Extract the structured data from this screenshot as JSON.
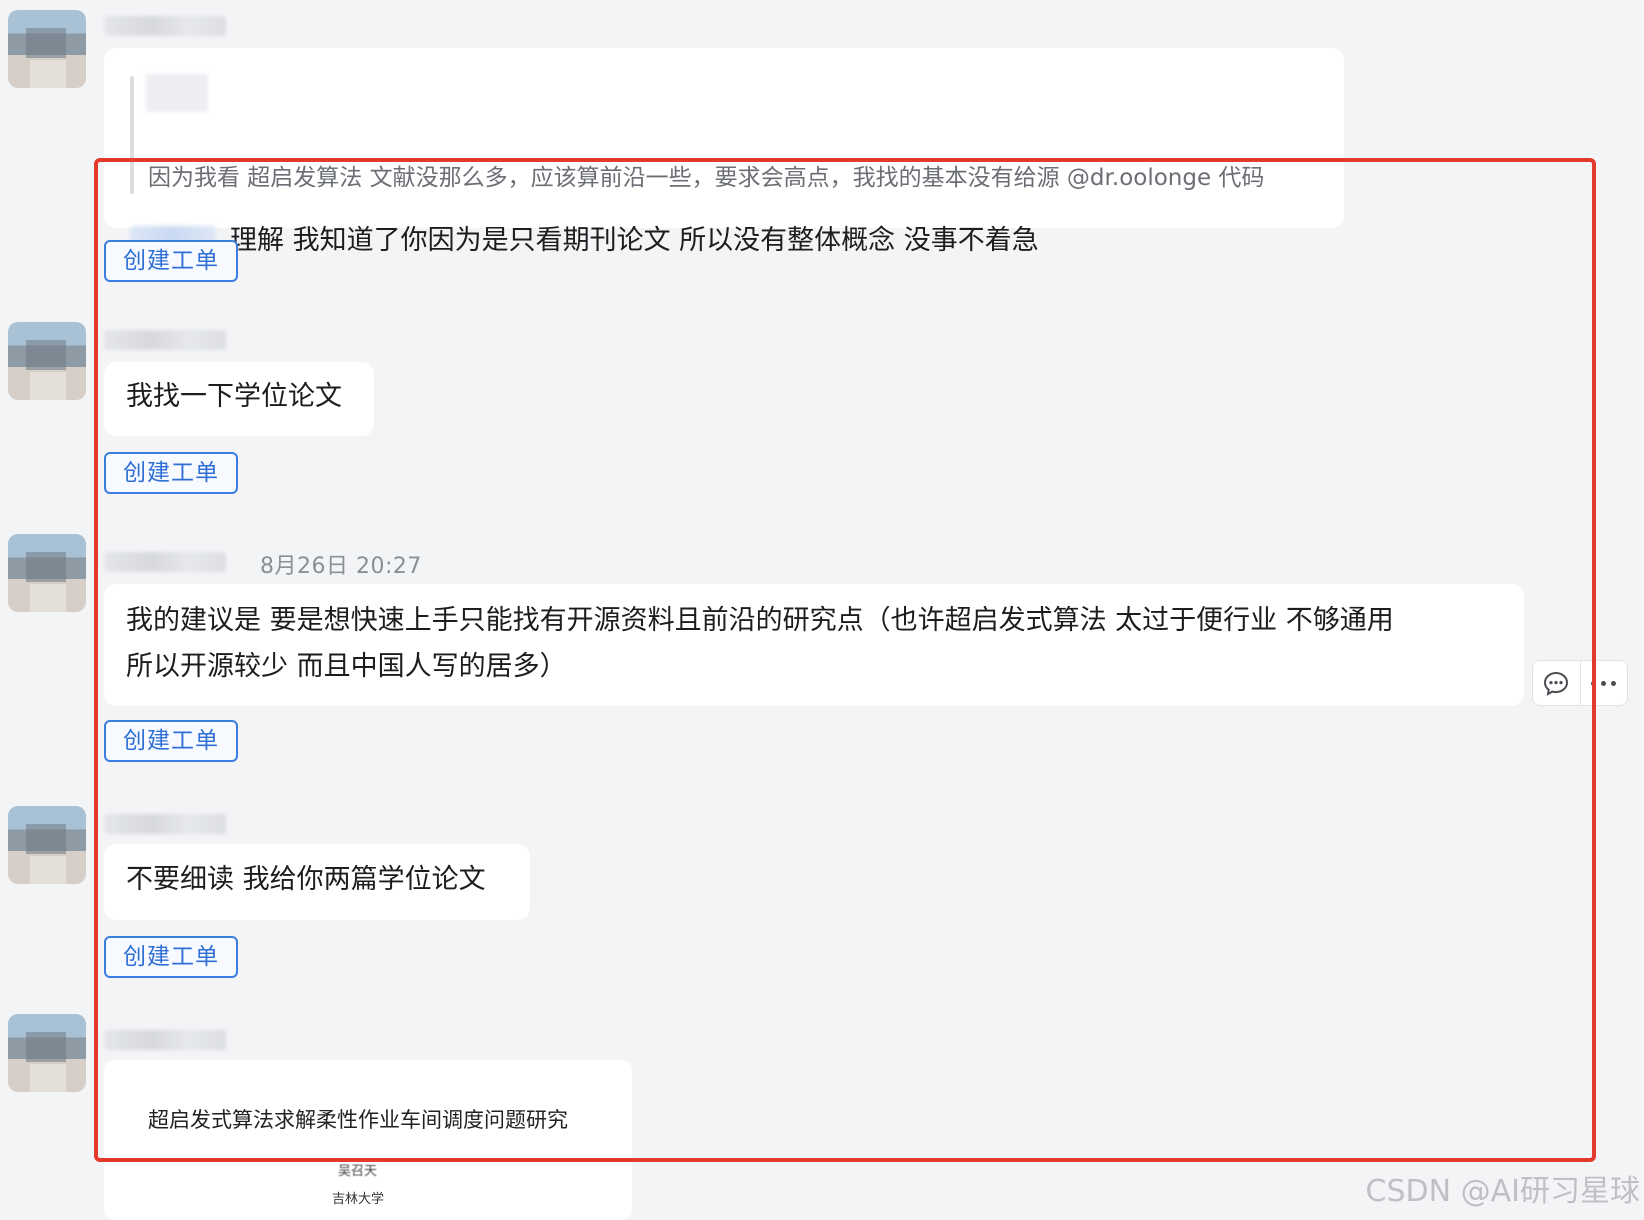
{
  "messages": [
    {
      "quote_text": "因为我看 超启发算法 文献没那么多，应该算前沿一些，要求会高点，我找的基本没有给源 @dr.oolonge 代码",
      "text": "理解 我知道了你因为是只看期刊论文 所以没有整体概念 没事不着急"
    },
    {
      "text": "我找一下学位论文"
    },
    {
      "time": "8月26日 20:27",
      "text_line1": "我的建议是 要是想快速上手只能找有开源资料且前沿的研究点（也许超启发式算法 太过于便行业 不够通用",
      "text_line2": "所以开源较少 而且中国人写的居多）"
    },
    {
      "text": "不要细读 我给你两篇学位论文"
    },
    {
      "card_title": "超启发式算法求解柔性作业车间调度问题研究",
      "card_school_top": "吴召天",
      "card_school": "吉林大学"
    }
  ],
  "ticket_button_label": "创建工单",
  "icons": {
    "reply": "comment-icon",
    "more": "more-dots-icon"
  },
  "colors": {
    "accent": "#3b7de0",
    "highlight": "#e23b2e",
    "background": "#f3f4f6"
  },
  "watermark": "CSDN @AI研习星球"
}
